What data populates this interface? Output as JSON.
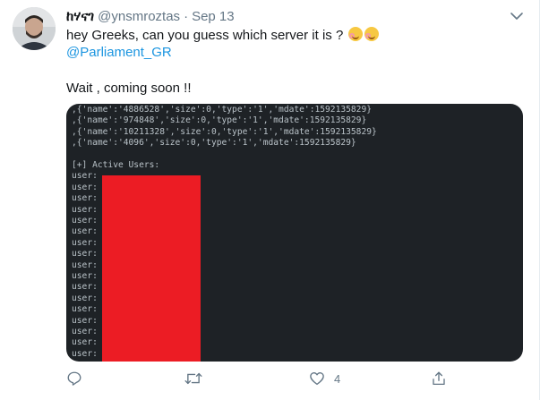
{
  "tweet": {
    "display_name": "ከሃናገ",
    "handle": "@ynsmroztas",
    "separator": "·",
    "date": "Sep 13",
    "text_line1": "hey Greeks, can you guess which server it is ?",
    "mention": "@Parliament_GR",
    "text_line2": "Wait , coming soon !!"
  },
  "terminal": {
    "lines": [
      ",{'name':'4886528','size':0,'type':'1','mdate':1592135829}",
      ",{'name':'974848','size':0,'type':'1','mdate':1592135829}",
      ",{'name':'10211328','size':0,'type':'1','mdate':1592135829}",
      ",{'name':'4096','size':0,'type':'1','mdate':1592135829}",
      "",
      "[+] Active Users:",
      "user:",
      "user:",
      "user:",
      "user:",
      "user:",
      "user:",
      "user:",
      "user:",
      "user:",
      "user:",
      "user:",
      "user:",
      "user:",
      "user:",
      "user:",
      "user:",
      "user:",
      "user:",
      "user:"
    ]
  },
  "actions": {
    "like_count": "4"
  },
  "colors": {
    "link": "#1b95e0",
    "secondary": "#657786",
    "terminal_bg": "#1e2226",
    "redaction": "#ec1c24"
  }
}
